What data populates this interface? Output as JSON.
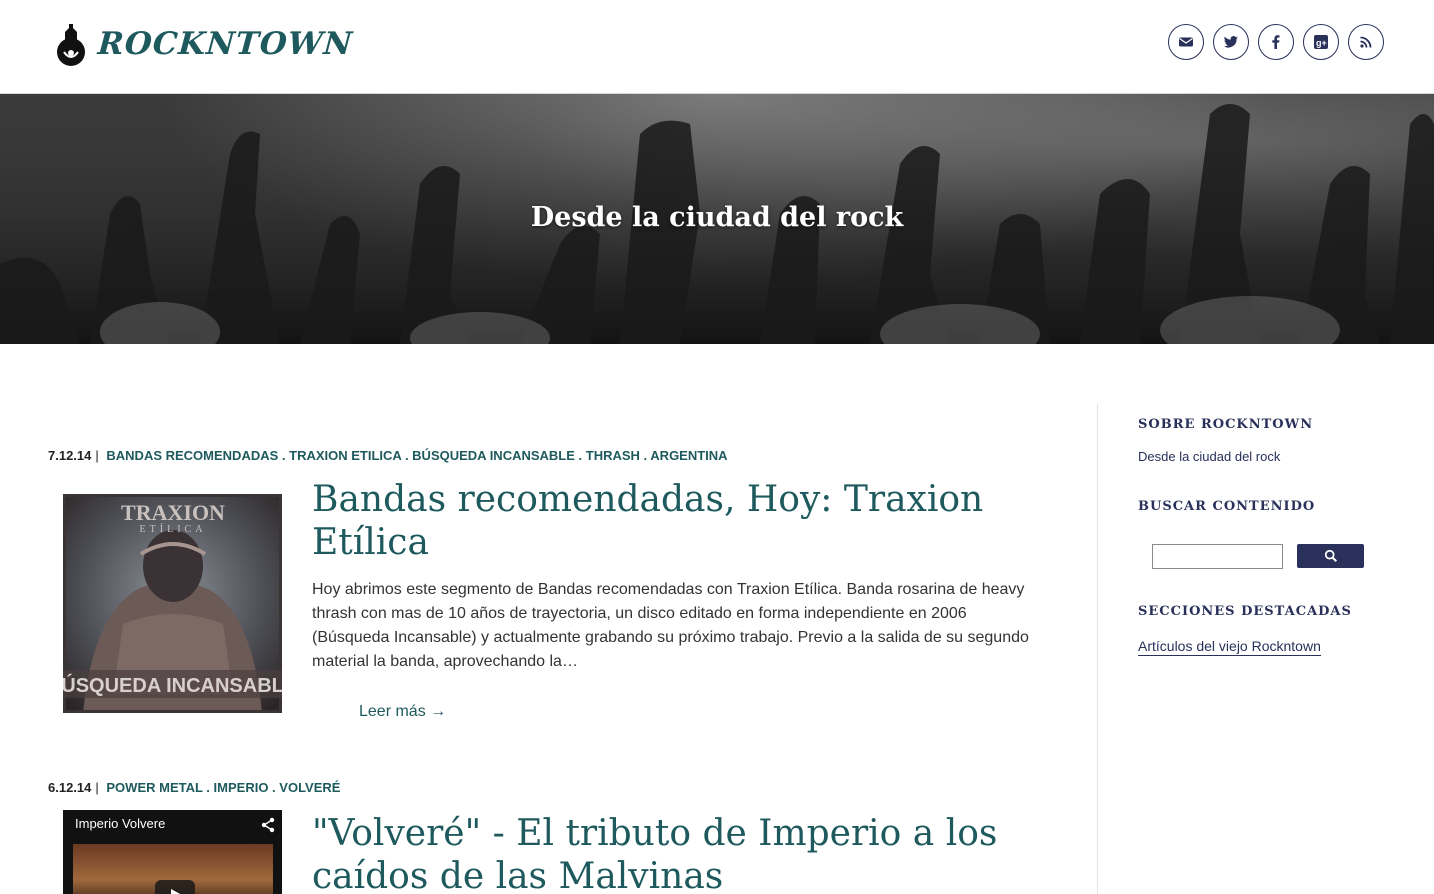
{
  "brand": {
    "name": "ROCKNTOWN",
    "color": "#1e5a5d",
    "accent": "#29305a"
  },
  "social": [
    {
      "icon": "mail-icon"
    },
    {
      "icon": "twitter-icon"
    },
    {
      "icon": "facebook-icon"
    },
    {
      "icon": "google-plus-icon"
    },
    {
      "icon": "rss-icon"
    }
  ],
  "hero": {
    "title": "Desde la ciudad del rock"
  },
  "posts": [
    {
      "date": "7.12.14",
      "tags": [
        "BANDAS RECOMENDADAS",
        "TRAXION ETILICA",
        "BÚSQUEDA INCANSABLE",
        "THRASH",
        "ARGENTINA"
      ],
      "title": "Bandas recomendadas, Hoy: Traxion Etílica",
      "excerpt": "Hoy abrimos este segmento de Bandas recomendadas con Traxion Etílica. Banda rosarina de heavy thrash con mas de 10 años de trayectoria, un disco editado en forma independiente en 2006 (Búsqueda Incansable) y actualmente grabando su próximo trabajo. Previo a la salida de su segundo material la banda, aprovechando la…",
      "read_more": "Leer más →",
      "thumb": {
        "top_text": "TRAXION",
        "sub_text": "ETÍLICA",
        "bottom_text": "BÚSQUEDA INCANSABLE"
      }
    },
    {
      "date": "6.12.14",
      "tags": [
        "POWER METAL",
        "IMPERIO",
        "VOLVERÉ"
      ],
      "title": "\"Volveré\" - El tributo de Imperio a los caídos de las Malvinas",
      "thumb": {
        "video_title": "Imperio Volvere"
      }
    }
  ],
  "sidebar": {
    "about_title": "SOBRE ROCKNTOWN",
    "about_text": "Desde la ciudad del rock",
    "search_title": "BUSCAR CONTENIDO",
    "search_value": "",
    "featured_title": "SECCIONES DESTACADAS",
    "featured_link": "Artículos del viejo Rockntown"
  }
}
